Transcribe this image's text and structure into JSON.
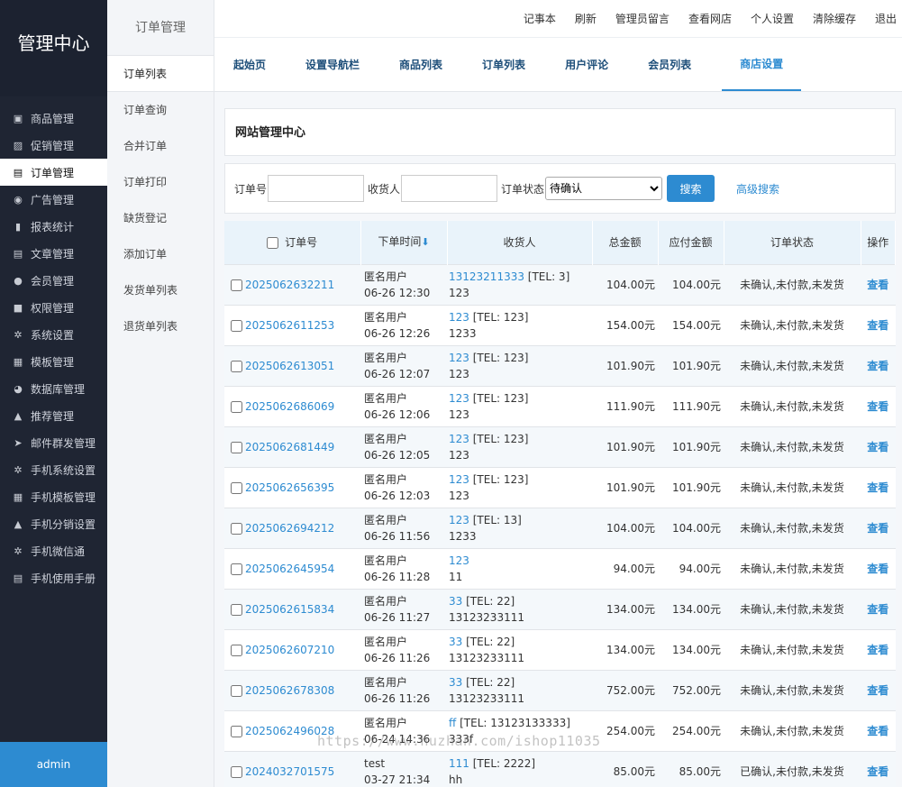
{
  "sidebar": {
    "brand": "管理中心",
    "items": [
      {
        "label": "商品管理",
        "icon": "bookmark-icon",
        "glyph": "▣",
        "active": false
      },
      {
        "label": "促销管理",
        "icon": "chart-icon",
        "glyph": "▨",
        "active": false
      },
      {
        "label": "订单管理",
        "icon": "clipboard-icon",
        "glyph": "▤",
        "active": true
      },
      {
        "label": "广告管理",
        "icon": "ad-icon",
        "glyph": "◉",
        "active": false
      },
      {
        "label": "报表统计",
        "icon": "bar-chart-icon",
        "glyph": "▮",
        "active": false
      },
      {
        "label": "文章管理",
        "icon": "document-icon",
        "glyph": "▤",
        "active": false
      },
      {
        "label": "会员管理",
        "icon": "user-icon",
        "glyph": "●",
        "active": false
      },
      {
        "label": "权限管理",
        "icon": "lock-icon",
        "glyph": "■",
        "active": false
      },
      {
        "label": "系统设置",
        "icon": "gear-icon",
        "glyph": "✲",
        "active": false
      },
      {
        "label": "模板管理",
        "icon": "layout-icon",
        "glyph": "▦",
        "active": false
      },
      {
        "label": "数据库管理",
        "icon": "pie-chart-icon",
        "glyph": "◕",
        "active": false
      },
      {
        "label": "推荐管理",
        "icon": "thumbs-up-icon",
        "glyph": "▲",
        "active": false
      },
      {
        "label": "邮件群发管理",
        "icon": "send-icon",
        "glyph": "➤",
        "active": false
      },
      {
        "label": "手机系统设置",
        "icon": "gear-icon",
        "glyph": "✲",
        "active": false
      },
      {
        "label": "手机模板管理",
        "icon": "layout-icon",
        "glyph": "▦",
        "active": false
      },
      {
        "label": "手机分销设置",
        "icon": "thumbs-up-icon",
        "glyph": "▲",
        "active": false
      },
      {
        "label": "手机微信通",
        "icon": "gear-icon",
        "glyph": "✲",
        "active": false
      },
      {
        "label": "手机使用手册",
        "icon": "document-icon",
        "glyph": "▤",
        "active": false
      }
    ],
    "user": "admin"
  },
  "subnav": {
    "title": "订单管理",
    "items": [
      "订单列表",
      "订单查询",
      "合并订单",
      "订单打印",
      "缺货登记",
      "添加订单",
      "发货单列表",
      "退货单列表"
    ]
  },
  "topbar": {
    "links": [
      "记事本",
      "刷新",
      "管理员留言",
      "查看网店",
      "个人设置",
      "清除缓存",
      "退出"
    ]
  },
  "tabs": [
    "起始页",
    "设置导航栏",
    "商品列表",
    "订单列表",
    "用户评论",
    "会员列表",
    "商店设置"
  ],
  "panel_title": "网站管理中心",
  "search": {
    "order_no_label": "订单号",
    "consignee_label": "收货人",
    "status_label": "订单状态",
    "status_selected": "待确认",
    "search_button": "搜索",
    "advanced_link": "高级搜索"
  },
  "table": {
    "headers": [
      "订单号",
      "下单时间",
      "收货人",
      "总金额",
      "应付金额",
      "订单状态",
      "操作"
    ],
    "sort_arrow": "⬇",
    "rows": [
      {
        "id": "2025062632211",
        "user": "匿名用户",
        "time": "06-26 12:30",
        "rcv": "13123211333",
        "tel": " [TEL: 3]",
        "addr": "123",
        "total": "104.00元",
        "pay": "104.00元",
        "status": "未确认,未付款,未发货",
        "op": "查看"
      },
      {
        "id": "2025062611253",
        "user": "匿名用户",
        "time": "06-26 12:26",
        "rcv": "123",
        "tel": " [TEL: 123]",
        "addr": "1233",
        "total": "154.00元",
        "pay": "154.00元",
        "status": "未确认,未付款,未发货",
        "op": "查看"
      },
      {
        "id": "2025062613051",
        "user": "匿名用户",
        "time": "06-26 12:07",
        "rcv": "123",
        "tel": " [TEL: 123]",
        "addr": "123",
        "total": "101.90元",
        "pay": "101.90元",
        "status": "未确认,未付款,未发货",
        "op": "查看"
      },
      {
        "id": "2025062686069",
        "user": "匿名用户",
        "time": "06-26 12:06",
        "rcv": "123",
        "tel": " [TEL: 123]",
        "addr": "123",
        "total": "111.90元",
        "pay": "111.90元",
        "status": "未确认,未付款,未发货",
        "op": "查看"
      },
      {
        "id": "2025062681449",
        "user": "匿名用户",
        "time": "06-26 12:05",
        "rcv": "123",
        "tel": " [TEL: 123]",
        "addr": "123",
        "total": "101.90元",
        "pay": "101.90元",
        "status": "未确认,未付款,未发货",
        "op": "查看"
      },
      {
        "id": "2025062656395",
        "user": "匿名用户",
        "time": "06-26 12:03",
        "rcv": "123",
        "tel": " [TEL: 123]",
        "addr": "123",
        "total": "101.90元",
        "pay": "101.90元",
        "status": "未确认,未付款,未发货",
        "op": "查看"
      },
      {
        "id": "2025062694212",
        "user": "匿名用户",
        "time": "06-26 11:56",
        "rcv": "123",
        "tel": " [TEL: 13]",
        "addr": "1233",
        "total": "104.00元",
        "pay": "104.00元",
        "status": "未确认,未付款,未发货",
        "op": "查看"
      },
      {
        "id": "2025062645954",
        "user": "匿名用户",
        "time": "06-26 11:28",
        "rcv": "123",
        "tel": "",
        "addr": "11",
        "total": "94.00元",
        "pay": "94.00元",
        "status": "未确认,未付款,未发货",
        "op": "查看"
      },
      {
        "id": "2025062615834",
        "user": "匿名用户",
        "time": "06-26 11:27",
        "rcv": "33",
        "tel": " [TEL: 22]",
        "addr": "13123233111",
        "total": "134.00元",
        "pay": "134.00元",
        "status": "未确认,未付款,未发货",
        "op": "查看"
      },
      {
        "id": "2025062607210",
        "user": "匿名用户",
        "time": "06-26 11:26",
        "rcv": "33",
        "tel": " [TEL: 22]",
        "addr": "13123233111",
        "total": "134.00元",
        "pay": "134.00元",
        "status": "未确认,未付款,未发货",
        "op": "查看"
      },
      {
        "id": "2025062678308",
        "user": "匿名用户",
        "time": "06-26 11:26",
        "rcv": "33",
        "tel": " [TEL: 22]",
        "addr": "13123233111",
        "total": "752.00元",
        "pay": "752.00元",
        "status": "未确认,未付款,未发货",
        "op": "查看"
      },
      {
        "id": "2025062496028",
        "user": "匿名用户",
        "time": "06-24 14:36",
        "rcv": "ff",
        "tel": " [TEL: 13123133333]",
        "addr": "333f",
        "total": "254.00元",
        "pay": "254.00元",
        "status": "未确认,未付款,未发货",
        "op": "查看"
      },
      {
        "id": "2024032701575",
        "user": "test",
        "time": "03-27 21:34",
        "rcv": "111",
        "tel": " [TEL: 2222]",
        "addr": "hh",
        "total": "85.00元",
        "pay": "85.00元",
        "status": "已确认,未付款,未发货",
        "op": "查看"
      }
    ]
  },
  "watermark": "https://www.huzhan.com/ishop11035",
  "colors": {
    "accent": "#2d8bd1",
    "sidebar_bg": "#1f2533"
  }
}
